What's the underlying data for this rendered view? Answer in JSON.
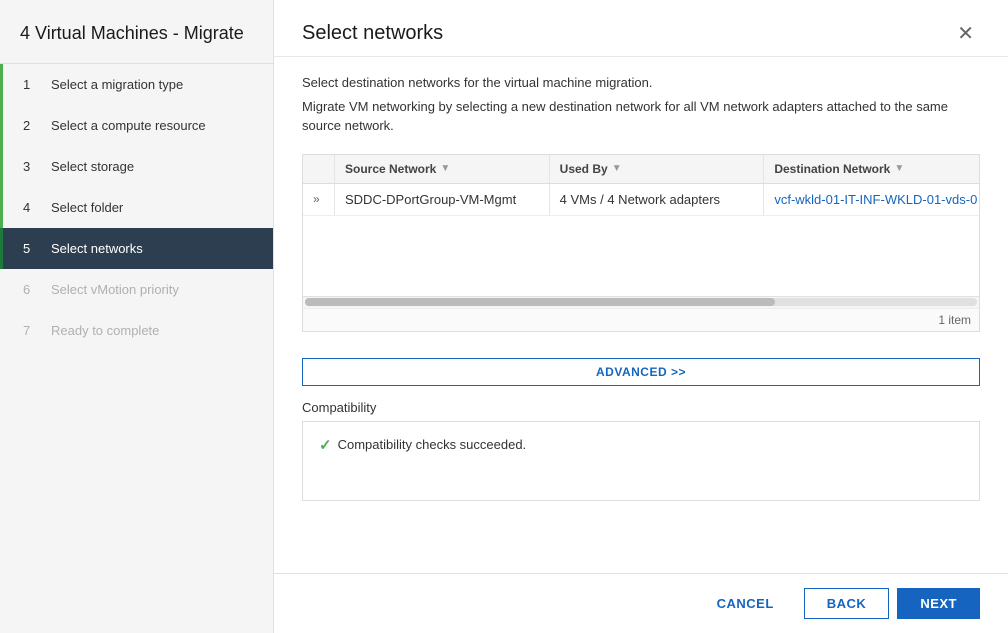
{
  "sidebar": {
    "title": "4 Virtual Machines - Migrate",
    "steps": [
      {
        "number": "1",
        "label": "Select a migration type",
        "state": "completed"
      },
      {
        "number": "2",
        "label": "Select a compute resource",
        "state": "completed"
      },
      {
        "number": "3",
        "label": "Select storage",
        "state": "completed"
      },
      {
        "number": "4",
        "label": "Select folder",
        "state": "completed"
      },
      {
        "number": "5",
        "label": "Select networks",
        "state": "active"
      },
      {
        "number": "6",
        "label": "Select vMotion priority",
        "state": "disabled"
      },
      {
        "number": "7",
        "label": "Ready to complete",
        "state": "disabled"
      }
    ]
  },
  "main": {
    "title": "Select networks",
    "description1": "Select destination networks for the virtual machine migration.",
    "description2": "Migrate VM networking by selecting a new destination network for all VM network adapters attached to the same source network.",
    "table": {
      "columns": [
        {
          "label": "",
          "key": "expand"
        },
        {
          "label": "Source Network",
          "key": "sourceNetwork"
        },
        {
          "label": "Used By",
          "key": "usedBy"
        },
        {
          "label": "Destination Network",
          "key": "destinationNetwork"
        }
      ],
      "rows": [
        {
          "expand": "»",
          "sourceNetwork": "SDDC-DPortGroup-VM-Mgmt",
          "usedBy": "4 VMs / 4 Network adapters",
          "destinationNetwork": "vcf-wkld-01-IT-INF-WKLD-01-vds-0"
        }
      ],
      "footer": "1 item"
    },
    "advancedButton": "ADVANCED >>",
    "compatibilityLabel": "Compatibility",
    "compatibilityMessage": "Compatibility checks succeeded.",
    "footer": {
      "cancelLabel": "CANCEL",
      "backLabel": "BACK",
      "nextLabel": "NEXT"
    }
  },
  "icons": {
    "close": "✕",
    "sortFilter": "▼",
    "checkmark": "✓",
    "expand": "»"
  }
}
